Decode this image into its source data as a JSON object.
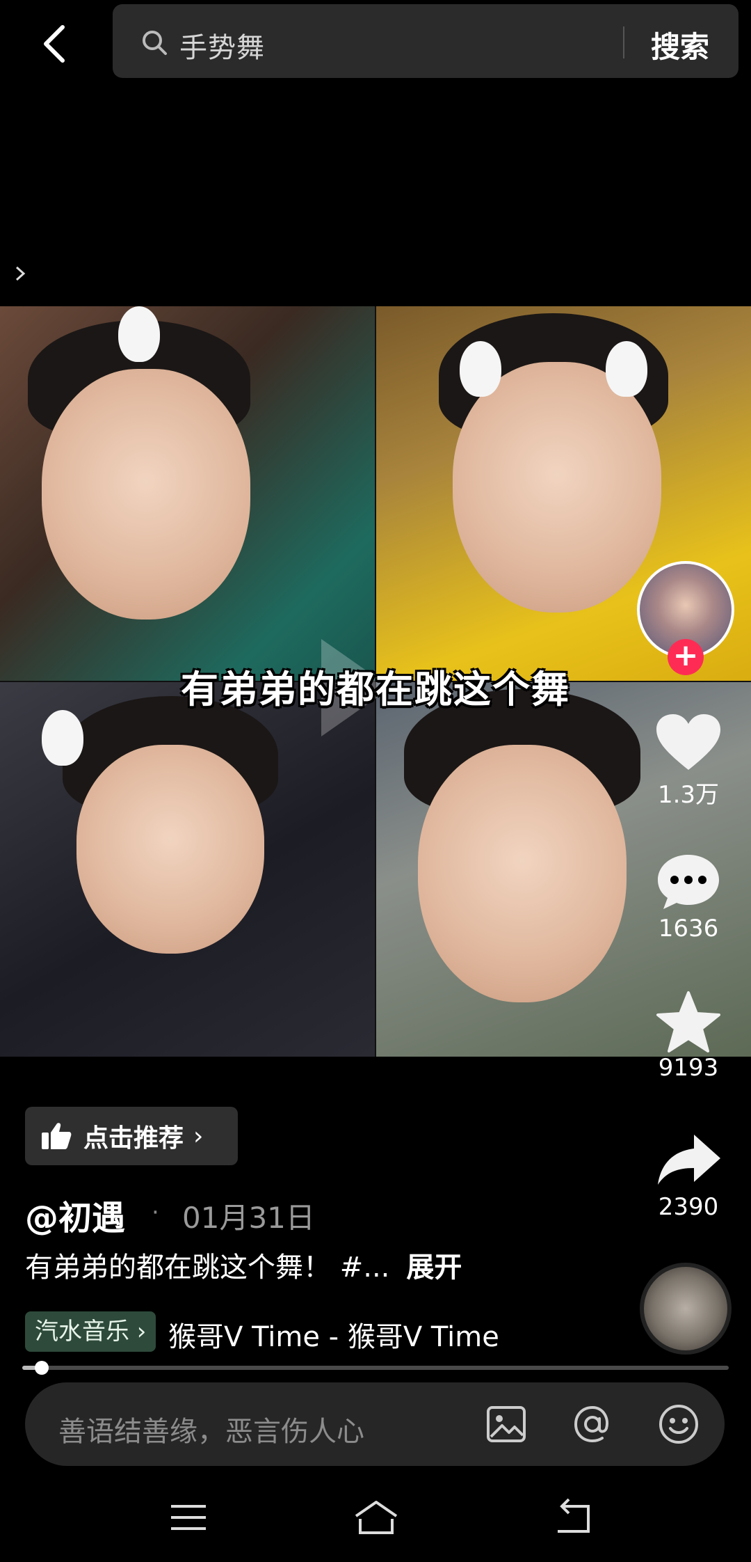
{
  "search": {
    "query": "手势舞",
    "submit_label": "搜索"
  },
  "video": {
    "caption": "有弟弟的都在跳这个舞"
  },
  "actions": {
    "likes": "1.3万",
    "comments": "1636",
    "favorites": "9193",
    "shares": "2390"
  },
  "recommend": {
    "label": "点击推荐"
  },
  "post": {
    "author": "@初遇",
    "separator": "·",
    "date": "01月31日",
    "description": "有弟弟的都在跳这个舞！ #...",
    "expand_label": "展开"
  },
  "music": {
    "tag": "汽水音乐",
    "title": "猴哥V   Time - 猴哥V   Time"
  },
  "progress": {
    "fraction": 0.02
  },
  "comment": {
    "placeholder": "善语结善缘，恶言伤人心"
  },
  "colors": {
    "accent": "#fe2c55",
    "music_tag": "#2e4a3a",
    "background": "#000000"
  },
  "icons": [
    "back-arrow-icon",
    "search-icon",
    "heart-icon",
    "comment-icon",
    "star-icon",
    "share-icon",
    "image-icon",
    "at-icon",
    "emoji-icon",
    "menu-icon",
    "home-icon",
    "return-icon"
  ]
}
